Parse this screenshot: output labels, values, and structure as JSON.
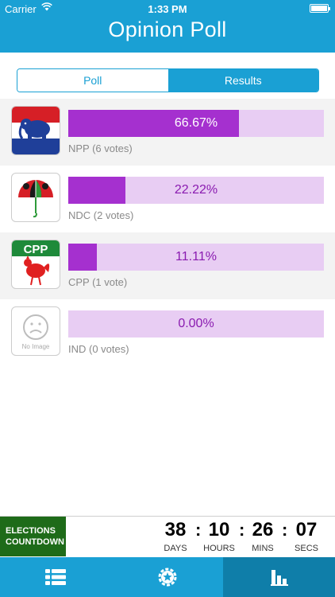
{
  "status_bar": {
    "carrier": "Carrier",
    "time": "1:33 PM"
  },
  "header": {
    "title": "Opinion Poll"
  },
  "segmented": {
    "poll_label": "Poll",
    "results_label": "Results",
    "selected": "Results"
  },
  "colors": {
    "accent": "#1aa0d4",
    "bar_fill": "#a530cf",
    "bar_track": "#e8cdf3",
    "countdown_label_bg": "#1e6b19"
  },
  "results": [
    {
      "party": "NPP",
      "percent_label": "66.67%",
      "share": 0.6667,
      "votes_label": "NPP (6 votes)",
      "logo": "npp-elephant-logo"
    },
    {
      "party": "NDC",
      "percent_label": "22.22%",
      "share": 0.2222,
      "votes_label": "NDC (2 votes)",
      "logo": "ndc-umbrella-logo"
    },
    {
      "party": "CPP",
      "percent_label": "11.11%",
      "share": 0.1111,
      "votes_label": "CPP (1 vote)",
      "logo": "cpp-cockerel-logo",
      "logo_text": "CPP"
    },
    {
      "party": "IND",
      "percent_label": "0.00%",
      "share": 0,
      "votes_label": "IND (0 votes)",
      "logo": "no-image-placeholder",
      "logo_text": "No Image"
    }
  ],
  "countdown": {
    "label_line1": "ELECTIONS",
    "label_line2": "COUNTDOWN",
    "days": "38",
    "days_label": "DAYS",
    "hours": "10",
    "hours_label": "HOURS",
    "mins": "26",
    "mins_label": "MINS",
    "secs": "07",
    "secs_label": "SECS",
    "separator": ":"
  },
  "tabbar": {
    "items": [
      {
        "icon": "list-icon"
      },
      {
        "icon": "settings-star-icon"
      },
      {
        "icon": "bar-chart-icon",
        "selected": true
      }
    ]
  }
}
